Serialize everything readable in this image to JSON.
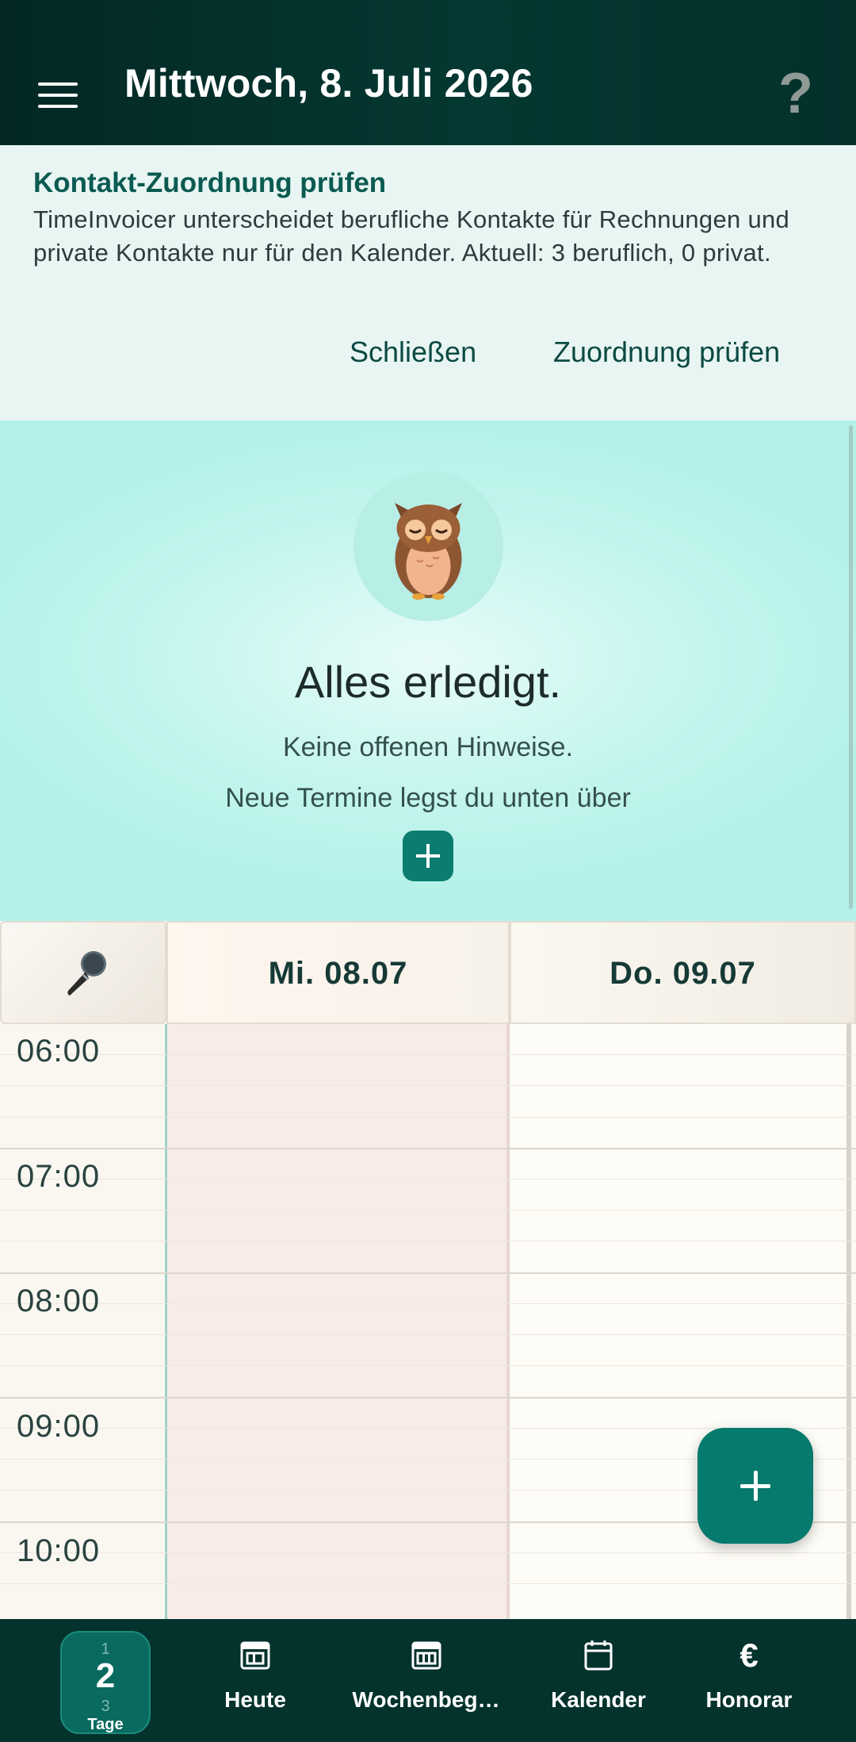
{
  "appbar": {
    "title": "Mittwoch, 8. Juli 2026",
    "help_label": "?"
  },
  "banner": {
    "title": "Kontakt-Zuordnung prüfen",
    "text": "TimeInvoicer unterscheidet berufliche Kontakte für Rechnungen und private Kontakte nur für den Kalender. Aktuell: 3 beruflich, 0 privat.",
    "close_label": "Schließen",
    "review_label": "Zuordnung prüfen"
  },
  "hero": {
    "title": "Alles erledigt.",
    "line1": "Keine offenen Hinweise.",
    "line2": "Neue Termine legst du unten über"
  },
  "calendar": {
    "days": [
      "Mi. 08.07",
      "Do. 09.07"
    ],
    "times": [
      "06:00",
      "07:00",
      "08:00",
      "09:00",
      "10:00"
    ]
  },
  "bottomnav": {
    "days_toggle": {
      "top": "1",
      "value": "2",
      "bottom": "3",
      "label": "Tage"
    },
    "items": [
      "Heute",
      "Wochenbeg…",
      "Kalender",
      "Honorar"
    ],
    "currency_symbol": "€"
  },
  "colors": {
    "appbar": "#032824",
    "accent": "#0a7d70",
    "banner_bg": "#e8f5f2",
    "hero_bg": "#b4f1e9"
  },
  "icons": {
    "menu": "hamburger-icon",
    "help": "help-icon",
    "owl": "owl-icon",
    "mic": "microphone-icon",
    "today": "today-calendar-icon",
    "week": "week-calendar-icon",
    "calendar": "calendar-icon",
    "fee": "euro-icon"
  }
}
